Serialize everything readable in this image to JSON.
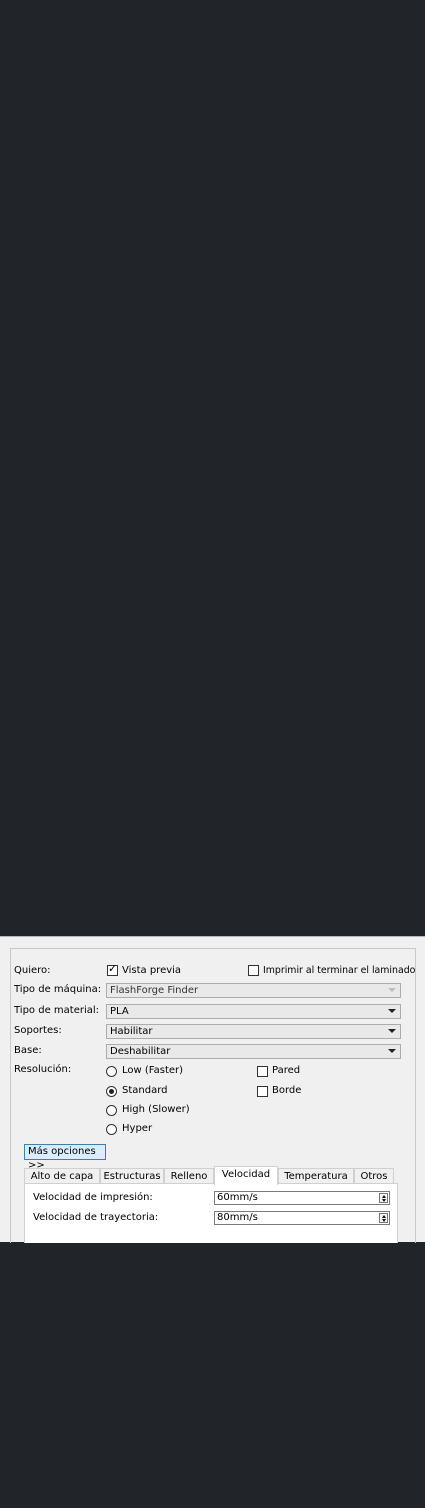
{
  "form": {
    "quiero_label": "Quiero:",
    "vista_previa_label": "Vista previa",
    "vista_previa_checked": true,
    "imprimir_label": "Imprimir al terminar el laminado",
    "imprimir_checked": false,
    "tipo_maquina_label": "Tipo de máquina:",
    "tipo_maquina_value": "FlashForge Finder",
    "tipo_material_label": "Tipo de material:",
    "tipo_material_value": "PLA",
    "soportes_label": "Soportes:",
    "soportes_value": "Habilitar",
    "base_label": "Base:",
    "base_value": "Deshabilitar",
    "resolucion_label": "Resolución:",
    "resolution_options": [
      "Low (Faster)",
      "Standard",
      "High (Slower)",
      "Hyper"
    ],
    "resolution_selected": "Standard",
    "pared_label": "Pared",
    "pared_checked": false,
    "borde_label": "Borde",
    "borde_checked": false,
    "more_options_label": "Más opciones >>"
  },
  "tabs": [
    "Alto de capa",
    "Estructuras",
    "Relleno",
    "Velocidad",
    "Temperatura",
    "Otros"
  ],
  "active_tab": "Velocidad",
  "velocidad": {
    "impresion_label": "Velocidad de impresión:",
    "impresion_value": "60mm/s",
    "trayectoria_label": "Velocidad de trayectoria:",
    "trayectoria_value": "80mm/s"
  },
  "colors": {
    "background": "#212429",
    "dialog": "#f0f0f0",
    "button_highlight": "#dcecfc"
  }
}
